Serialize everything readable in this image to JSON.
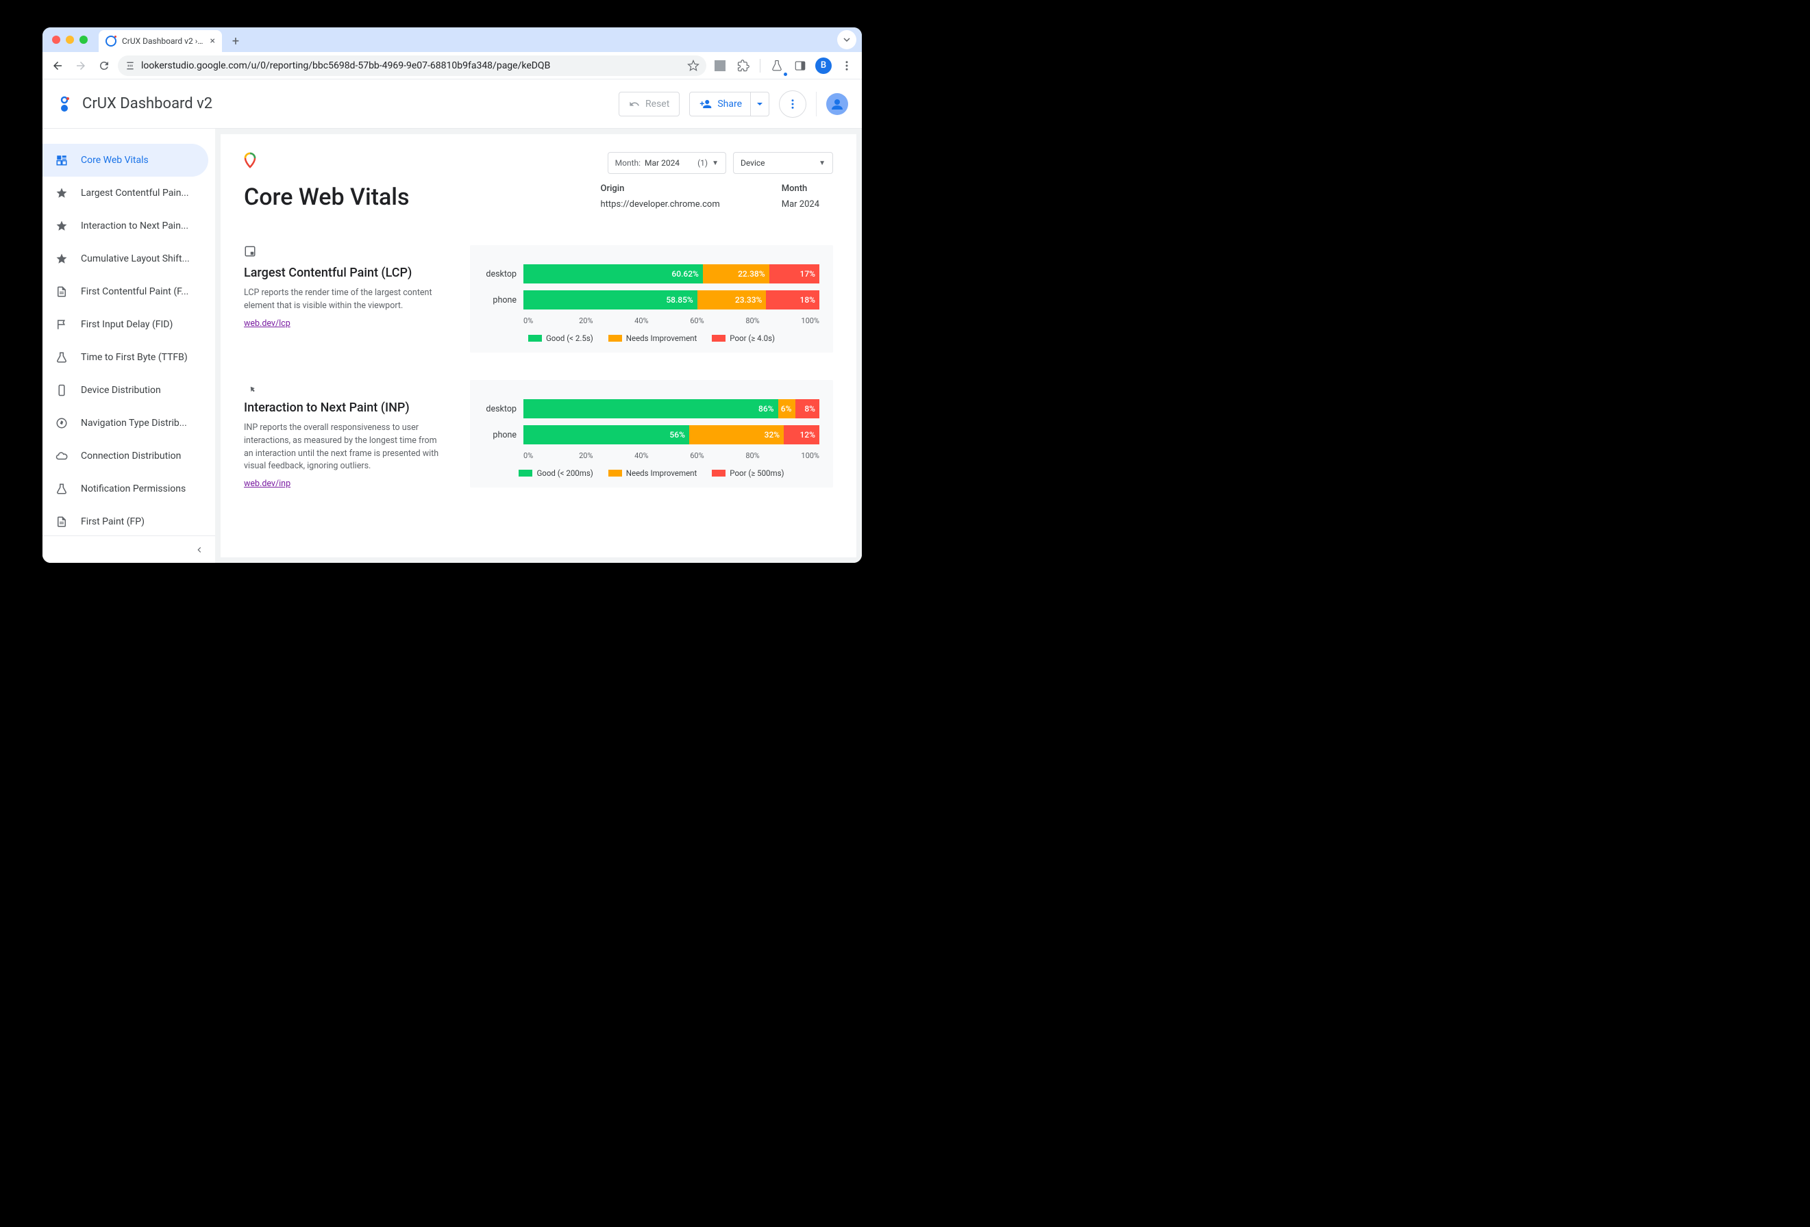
{
  "browser": {
    "tab_title": "CrUX Dashboard v2 › Core W...",
    "url": "lookerstudio.google.com/u/0/reporting/bbc5698d-57bb-4969-9e07-68810b9fa348/page/keDQB",
    "avatar_letter": "B"
  },
  "header": {
    "app_title": "CrUX Dashboard v2",
    "reset_label": "Reset",
    "share_label": "Share"
  },
  "sidebar": {
    "items": [
      {
        "label": "Core Web Vitals",
        "icon": "dashboard",
        "active": true
      },
      {
        "label": "Largest Contentful Pain...",
        "icon": "star"
      },
      {
        "label": "Interaction to Next Pain...",
        "icon": "star"
      },
      {
        "label": "Cumulative Layout Shift...",
        "icon": "star"
      },
      {
        "label": "First Contentful Paint (F...",
        "icon": "doc"
      },
      {
        "label": "First Input Delay (FID)",
        "icon": "flag"
      },
      {
        "label": "Time to First Byte (TTFB)",
        "icon": "flask"
      },
      {
        "label": "Device Distribution",
        "icon": "device"
      },
      {
        "label": "Navigation Type Distrib...",
        "icon": "compass"
      },
      {
        "label": "Connection Distribution",
        "icon": "cloud"
      },
      {
        "label": "Notification Permissions",
        "icon": "flask"
      },
      {
        "label": "First Paint (FP)",
        "icon": "doc"
      }
    ]
  },
  "filters": {
    "month_label": "Month:",
    "month_value": "Mar 2024",
    "month_count": "(1)",
    "device_label": "Device"
  },
  "page_title": "Core Web Vitals",
  "meta": {
    "origin_label": "Origin",
    "origin_value": "https://developer.chrome.com",
    "month_label": "Month",
    "month_value": "Mar 2024"
  },
  "metrics": [
    {
      "id": "lcp",
      "title": "Largest Contentful Paint (LCP)",
      "desc": "LCP reports the render time of the largest content element that is visible within the viewport.",
      "link": "web.dev/lcp",
      "legend": {
        "good": "Good (< 2.5s)",
        "ni": "Needs Improvement",
        "poor": "Poor (≥ 4.0s)"
      },
      "rows": [
        {
          "label": "desktop",
          "good": 60.62,
          "ni": 22.38,
          "poor": 17,
          "good_txt": "60.62%",
          "ni_txt": "22.38%",
          "poor_txt": "17%"
        },
        {
          "label": "phone",
          "good": 58.85,
          "ni": 23.33,
          "poor": 18,
          "good_txt": "58.85%",
          "ni_txt": "23.33%",
          "poor_txt": "18%"
        }
      ]
    },
    {
      "id": "inp",
      "title": "Interaction to Next Paint (INP)",
      "desc": "INP reports the overall responsiveness to user interactions, as measured by the longest time from an interaction until the next frame is presented with visual feedback, ignoring outliers.",
      "link": "web.dev/inp",
      "legend": {
        "good": "Good (< 200ms)",
        "ni": "Needs Improvement",
        "poor": "Poor (≥ 500ms)"
      },
      "rows": [
        {
          "label": "desktop",
          "good": 86,
          "ni": 6,
          "poor": 8,
          "good_txt": "86%",
          "ni_txt": "6%",
          "poor_txt": "8%"
        },
        {
          "label": "phone",
          "good": 56,
          "ni": 32,
          "poor": 12,
          "good_txt": "56%",
          "ni_txt": "32%",
          "poor_txt": "12%"
        }
      ]
    }
  ],
  "axis_ticks": [
    "0%",
    "20%",
    "40%",
    "60%",
    "80%",
    "100%"
  ],
  "chart_data": [
    {
      "type": "bar",
      "stacked": true,
      "orientation": "horizontal",
      "title": "Largest Contentful Paint (LCP)",
      "xlabel": "",
      "ylabel": "",
      "categories": [
        "desktop",
        "phone"
      ],
      "series": [
        {
          "name": "Good (< 2.5s)",
          "values": [
            60.62,
            58.85
          ],
          "color": "#0cce6b"
        },
        {
          "name": "Needs Improvement",
          "values": [
            22.38,
            23.33
          ],
          "color": "#ffa400"
        },
        {
          "name": "Poor (≥ 4.0s)",
          "values": [
            17,
            18
          ],
          "color": "#ff4e42"
        }
      ],
      "xlim": [
        0,
        100
      ],
      "xticks": [
        0,
        20,
        40,
        60,
        80,
        100
      ]
    },
    {
      "type": "bar",
      "stacked": true,
      "orientation": "horizontal",
      "title": "Interaction to Next Paint (INP)",
      "xlabel": "",
      "ylabel": "",
      "categories": [
        "desktop",
        "phone"
      ],
      "series": [
        {
          "name": "Good (< 200ms)",
          "values": [
            86,
            56
          ],
          "color": "#0cce6b"
        },
        {
          "name": "Needs Improvement",
          "values": [
            6,
            32
          ],
          "color": "#ffa400"
        },
        {
          "name": "Poor (≥ 500ms)",
          "values": [
            8,
            12
          ],
          "color": "#ff4e42"
        }
      ],
      "xlim": [
        0,
        100
      ],
      "xticks": [
        0,
        20,
        40,
        60,
        80,
        100
      ]
    }
  ]
}
